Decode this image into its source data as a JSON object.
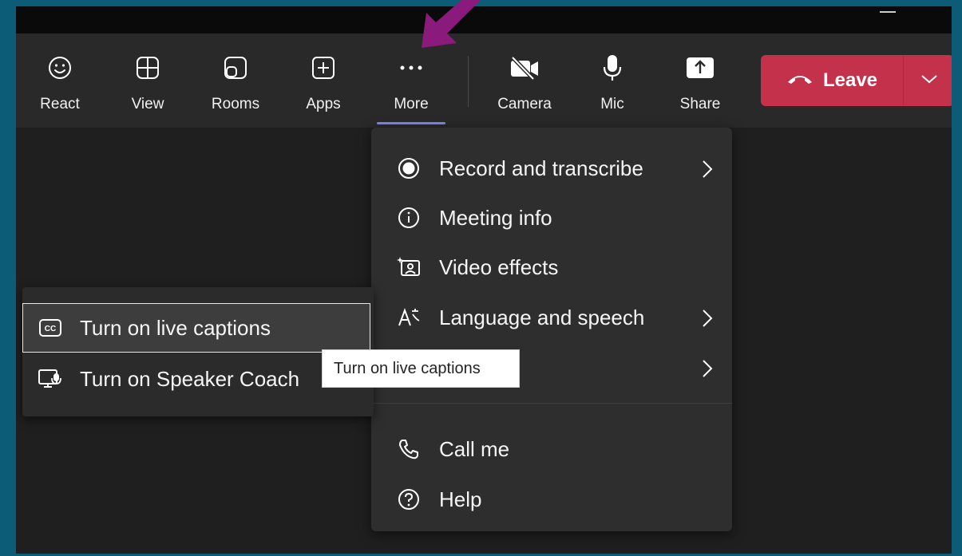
{
  "toolbar": {
    "buttons": [
      {
        "label": "React",
        "icon": "smiley-icon"
      },
      {
        "label": "View",
        "icon": "grid-view-icon"
      },
      {
        "label": "Rooms",
        "icon": "rooms-icon"
      },
      {
        "label": "Apps",
        "icon": "add-app-icon"
      },
      {
        "label": "More",
        "icon": "more-dots-icon",
        "active": true
      },
      {
        "label": "Camera",
        "icon": "camera-off-icon"
      },
      {
        "label": "Mic",
        "icon": "microphone-icon"
      },
      {
        "label": "Share",
        "icon": "share-screen-icon"
      }
    ],
    "leave_label": "Leave"
  },
  "more_menu": {
    "items": [
      {
        "label": "Record and transcribe",
        "icon": "record-icon",
        "has_submenu": true
      },
      {
        "label": "Meeting info",
        "icon": "info-icon"
      },
      {
        "label": "Video effects",
        "icon": "video-effects-icon"
      },
      {
        "label": "Language and speech",
        "icon": "language-icon",
        "has_submenu": true
      },
      {
        "label": "",
        "icon": "",
        "has_submenu": true
      },
      {
        "label": "Call me",
        "icon": "phone-icon"
      },
      {
        "label": "Help",
        "icon": "help-icon"
      }
    ]
  },
  "submenu": {
    "items": [
      {
        "label": "Turn on live captions",
        "icon": "captions-icon",
        "selected": true
      },
      {
        "label": "Turn on Speaker Coach",
        "icon": "speaker-coach-icon"
      }
    ]
  },
  "tooltip": {
    "text": "Turn on live captions"
  },
  "colors": {
    "accent": "#7f85f5",
    "leave": "#c4314b",
    "annotation_arrow": "#8a1a7c",
    "border": "#0c5b77"
  }
}
